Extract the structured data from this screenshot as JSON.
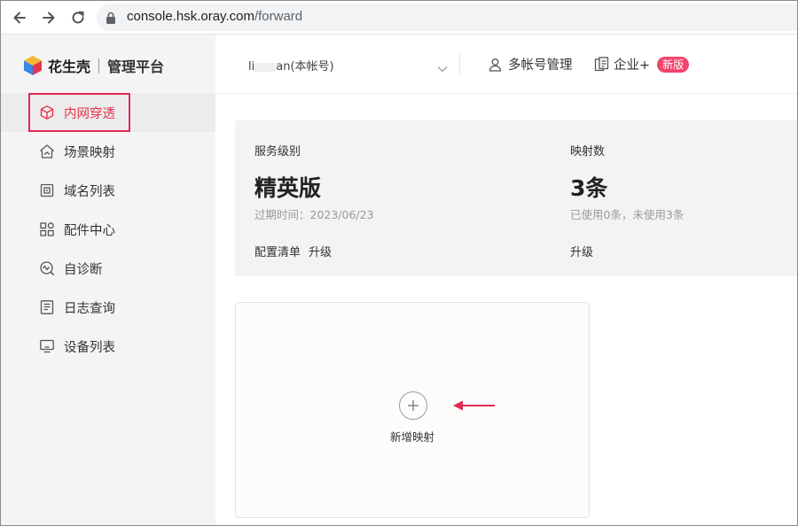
{
  "browser": {
    "url_domain": "console.hsk.oray.com",
    "url_path": "/forward",
    "icons": [
      "back-arrow-icon",
      "forward-arrow-icon",
      "reload-icon",
      "lock-icon"
    ]
  },
  "sidebar": {
    "brand": "花生壳",
    "platform": "管理平台",
    "items": [
      {
        "label": "内网穿透",
        "icon": "cube-icon",
        "active": true
      },
      {
        "label": "场景映射",
        "icon": "house-icon",
        "active": false
      },
      {
        "label": "域名列表",
        "icon": "domain-icon",
        "active": false
      },
      {
        "label": "配件中心",
        "icon": "grid-icon",
        "active": false
      },
      {
        "label": "自诊断",
        "icon": "diagnose-icon",
        "active": false
      },
      {
        "label": "日志查询",
        "icon": "log-icon",
        "active": false
      },
      {
        "label": "设备列表",
        "icon": "monitor-icon",
        "active": false
      }
    ]
  },
  "header": {
    "account_prefix": "li",
    "account_suffix": "an(本帐号)",
    "multi_account": "多帐号管理",
    "enterprise": "企业+",
    "new_badge": "新版"
  },
  "stats": {
    "service_level_label": "服务级别",
    "service_level_value": "精英版",
    "expire_text": "过期时间：2023/06/23",
    "config_list": "配置清单",
    "upgrade": "升级",
    "mapping_count_label": "映射数",
    "mapping_count_value": "3条",
    "mapping_usage": "已使用0条，未使用3条",
    "mapping_upgrade": "升级"
  },
  "add_mapping": {
    "label": "新增映射"
  },
  "colors": {
    "accent": "#e8344e",
    "highlight_border": "#e02a52",
    "badge": "#f2456a",
    "sidebar_bg": "#f4f4f4",
    "panel_bg": "#f3f3f3"
  }
}
